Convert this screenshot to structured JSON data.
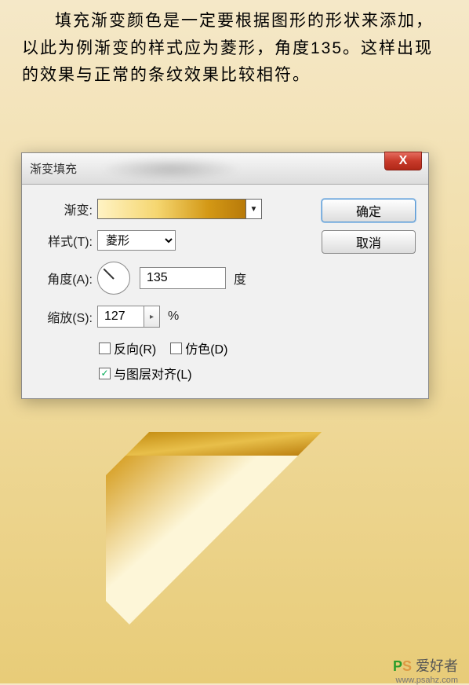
{
  "description": "填充渐变颜色是一定要根据图形的形状来添加，以此为例渐变的样式应为菱形，角度135。这样出现的效果与正常的条纹效果比较相符。",
  "dialog": {
    "title": "渐变填充",
    "close": "X",
    "ok": "确定",
    "cancel": "取消",
    "gradient_label": "渐变:",
    "style_label": "样式(T):",
    "style_value": "菱形",
    "angle_label": "角度(A):",
    "angle_value": "135",
    "angle_unit": "度",
    "scale_label": "缩放(S):",
    "scale_value": "127",
    "scale_unit": "%",
    "reverse_label": "反向(R)",
    "dither_label": "仿色(D)",
    "align_label": "与图层对齐(L)",
    "align_checked": "✓"
  },
  "watermark": {
    "p": "P",
    "s": "S",
    "text": "爱好者",
    "url": "www.psahz.com"
  }
}
